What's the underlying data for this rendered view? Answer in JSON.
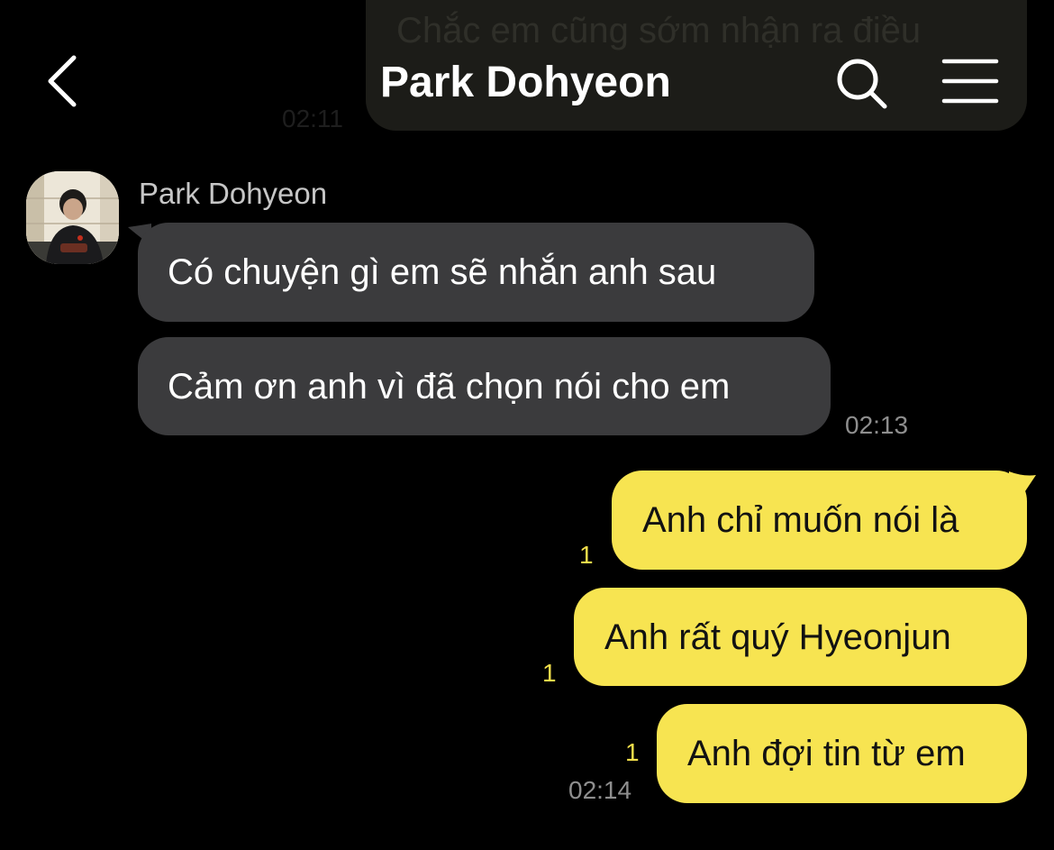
{
  "previous_message": {
    "text": "Chắc em cũng sớm nhận ra điều",
    "time": "02:11"
  },
  "header": {
    "title": "Park Dohyeon",
    "back_icon": "chevron-left-icon",
    "search_icon": "search-icon",
    "menu_icon": "menu-icon"
  },
  "incoming": {
    "sender": "Park Dohyeon",
    "messages": [
      {
        "text": "Có chuyện gì em sẽ nhắn anh sau"
      },
      {
        "text": "Cảm ơn anh vì đã chọn nói cho em"
      }
    ],
    "time": "02:13"
  },
  "outgoing": {
    "messages": [
      {
        "text": "Anh chỉ muốn nói là",
        "unread": "1"
      },
      {
        "text": "Anh rất quý Hyeonjun",
        "unread": "1"
      },
      {
        "text": "Anh đợi tin từ em",
        "unread": "1"
      }
    ],
    "time": "02:14"
  },
  "colors": {
    "background": "#000000",
    "incoming_bubble": "#3b3b3d",
    "outgoing_bubble": "#f7e451",
    "unread_count": "#f2de4b",
    "timestamp": "#8e8e8e"
  }
}
